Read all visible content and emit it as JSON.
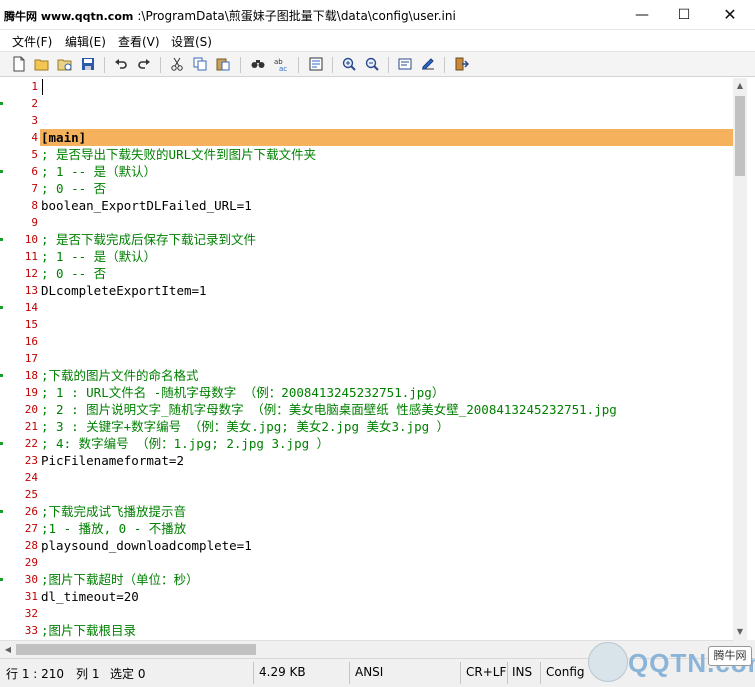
{
  "window": {
    "site_tag": "腾牛网 www.qqtn.com",
    "title_path": ":\\ProgramData\\煎蛋妹子图批量下载\\data\\config\\user.ini",
    "minimize_glyph": "—",
    "maximize_glyph": "☐",
    "close_glyph": "✕"
  },
  "menu": {
    "items": [
      "文件(F)",
      "编辑(E)",
      "查看(V)",
      "设置(S)"
    ]
  },
  "toolbar": {
    "icons": [
      "new-file-icon",
      "open-folder-icon",
      "open-recent-icon",
      "save-icon",
      "undo-icon",
      "redo-icon",
      "cut-icon",
      "copy-icon",
      "paste-icon",
      "find-icon",
      "replace-icon",
      "goto-icon",
      "zoom-in-icon",
      "zoom-out-icon",
      "word-wrap-icon",
      "settings-icon",
      "exit-icon"
    ]
  },
  "editor": {
    "highlight_line": 4,
    "lines": [
      {
        "n": "1",
        "text": "",
        "kind": "key"
      },
      {
        "n": "2",
        "text": "",
        "kind": "key"
      },
      {
        "n": "3",
        "text": "",
        "kind": "key"
      },
      {
        "n": "4",
        "text": "[main]",
        "kind": "section"
      },
      {
        "n": "5",
        "text": "; 是否导出下载失败的URL文件到图片下载文件夹",
        "kind": "comment"
      },
      {
        "n": "6",
        "text": "; 1 -- 是（默认）",
        "kind": "comment"
      },
      {
        "n": "7",
        "text": "; 0 -- 否",
        "kind": "comment"
      },
      {
        "n": "8",
        "text": "boolean_ExportDLFailed_URL=1",
        "kind": "key"
      },
      {
        "n": "9",
        "text": "",
        "kind": "key"
      },
      {
        "n": "10",
        "text": "; 是否下载完成后保存下载记录到文件",
        "kind": "comment"
      },
      {
        "n": "11",
        "text": "; 1 -- 是（默认）",
        "kind": "comment"
      },
      {
        "n": "12",
        "text": "; 0 -- 否",
        "kind": "comment"
      },
      {
        "n": "13",
        "text": "DLcompleteExportItem=1",
        "kind": "key"
      },
      {
        "n": "14",
        "text": "",
        "kind": "key"
      },
      {
        "n": "15",
        "text": "",
        "kind": "key"
      },
      {
        "n": "16",
        "text": "",
        "kind": "key"
      },
      {
        "n": "17",
        "text": "",
        "kind": "key"
      },
      {
        "n": "18",
        "text": ";下载的图片文件的命名格式",
        "kind": "comment"
      },
      {
        "n": "19",
        "text": "; 1 : URL文件名 -随机字母数字 （例：2008413245232751.jpg）",
        "kind": "comment"
      },
      {
        "n": "20",
        "text": "; 2 : 图片说明文字_随机字母数字 （例：美女电脑桌面壁纸 性感美女壁_2008413245232751.jpg",
        "kind": "comment"
      },
      {
        "n": "21",
        "text": "; 3 : 关键字+数字编号 （例：美女.jpg; 美女2.jpg 美女3.jpg ）",
        "kind": "comment"
      },
      {
        "n": "22",
        "text": "; 4: 数字编号 （例：1.jpg; 2.jpg 3.jpg ）",
        "kind": "comment"
      },
      {
        "n": "23",
        "text": "PicFilenameformat=2",
        "kind": "key"
      },
      {
        "n": "24",
        "text": "",
        "kind": "key"
      },
      {
        "n": "25",
        "text": "",
        "kind": "key"
      },
      {
        "n": "26",
        "text": ";下载完成试飞播放提示音",
        "kind": "comment"
      },
      {
        "n": "27",
        "text": ";1 - 播放, 0 - 不播放",
        "kind": "comment"
      },
      {
        "n": "28",
        "text": "playsound_downloadcomplete=1",
        "kind": "key"
      },
      {
        "n": "29",
        "text": "",
        "kind": "key"
      },
      {
        "n": "30",
        "text": ";图片下载超时（单位：秒）",
        "kind": "comment"
      },
      {
        "n": "31",
        "text": "dl_timeout=20",
        "kind": "key"
      },
      {
        "n": "32",
        "text": "",
        "kind": "key"
      },
      {
        "n": "33",
        "text": ";图片下载根目录",
        "kind": "comment"
      }
    ]
  },
  "status": {
    "line": "行 1 : 210",
    "column": "列 1",
    "selection": "选定 0",
    "size": "4.29 KB",
    "encoding": "ANSI",
    "eol": "CR+LF",
    "mode": "INS",
    "scheme": "Config"
  },
  "watermark": {
    "logo_text": "QQTN.com",
    "tag": "腾牛网"
  }
}
